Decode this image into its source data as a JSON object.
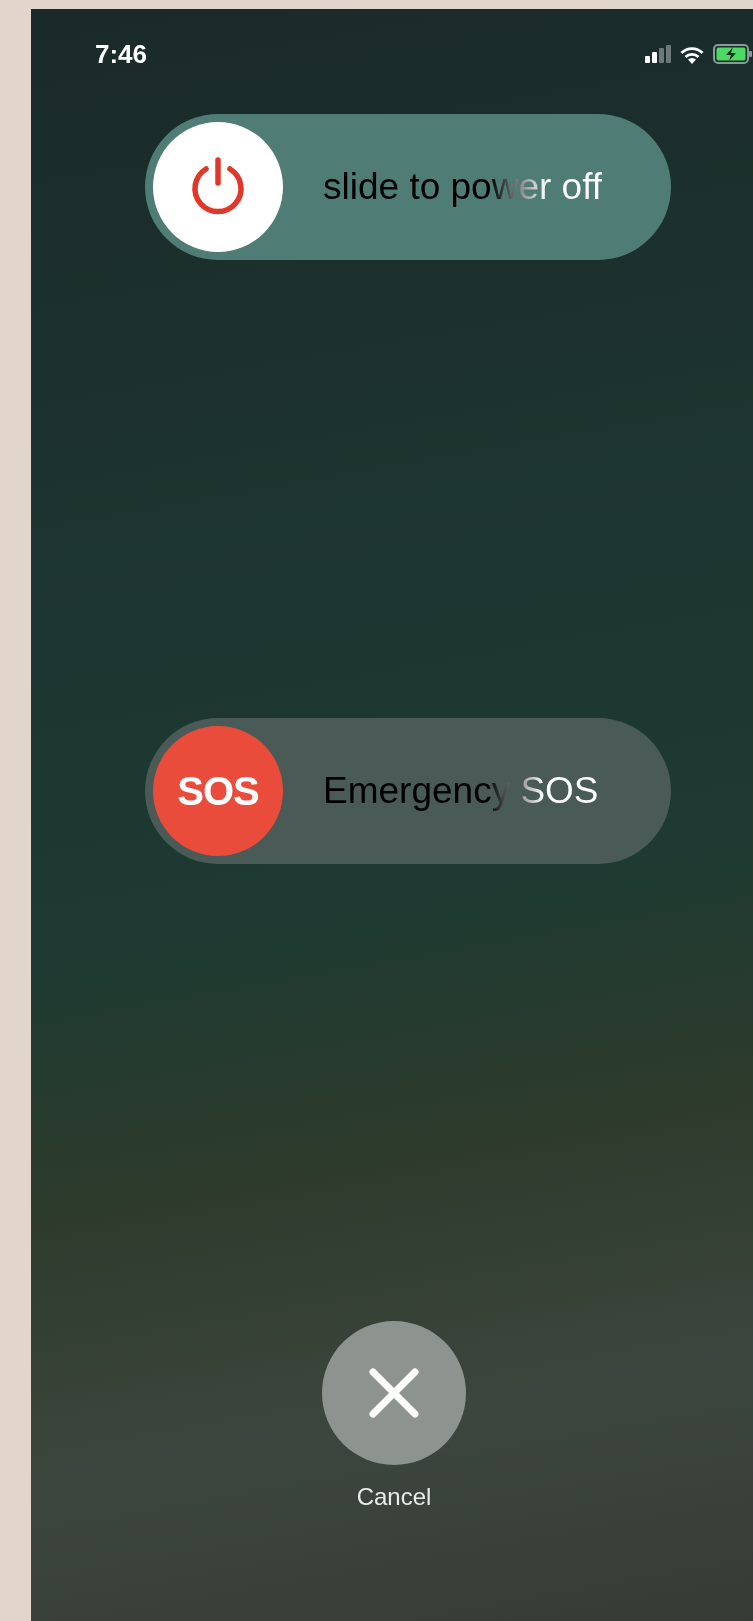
{
  "status_bar": {
    "time": "7:46"
  },
  "sliders": [
    {
      "kind": "power",
      "level": 0,
      "label": "slide to power off"
    },
    {
      "kind": "sos",
      "level": 0,
      "thumb_text": "SOS",
      "label": "Emergency SOS"
    }
  ],
  "cancel": {
    "label": "Cancel"
  }
}
